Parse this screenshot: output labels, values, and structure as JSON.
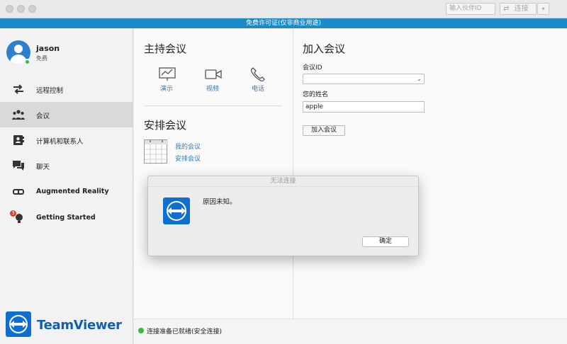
{
  "titlebar": {
    "partner_id_placeholder": "输入伙伴ID",
    "connect_label": "连接",
    "connect_dropdown": "▾"
  },
  "license_banner": "免费许可证(仅非商业用途)",
  "user": {
    "name": "jason",
    "plan": "免费"
  },
  "sidebar": {
    "items": [
      {
        "label": "远程控制",
        "icon": "arrows-icon",
        "active": false
      },
      {
        "label": "会议",
        "icon": "meeting-people-icon",
        "active": true
      },
      {
        "label": "计算机和联系人",
        "icon": "contacts-icon",
        "active": false
      },
      {
        "label": "聊天",
        "icon": "chat-icon",
        "active": false
      },
      {
        "label": "Augmented Reality",
        "icon": "ar-goggles-icon",
        "active": false
      },
      {
        "label": "Getting Started",
        "icon": "lightbulb-icon",
        "badge": "3",
        "active": false
      }
    ],
    "logo_text": "TeamViewer"
  },
  "host_meeting": {
    "title": "主持会议",
    "options": [
      {
        "label": "演示",
        "icon": "presentation-icon"
      },
      {
        "label": "视频",
        "icon": "video-camera-icon"
      },
      {
        "label": "电话",
        "icon": "phone-icon"
      }
    ]
  },
  "schedule_meeting": {
    "title": "安排会议",
    "links": [
      "我的会议",
      "安排会议"
    ]
  },
  "join_meeting": {
    "title": "加入会议",
    "meeting_id_label": "会议ID",
    "meeting_id_value": "",
    "name_label": "您的姓名",
    "name_value": "apple",
    "join_button": "加入会议"
  },
  "status": {
    "text": "连接准备已就绪(安全连接)",
    "color": "#3db547"
  },
  "dialog": {
    "title": "无法连接",
    "message": "原因未知。",
    "ok_button": "确定"
  },
  "colors": {
    "accent": "#1a8ac9",
    "link": "#2b7bc4",
    "brand": "#0e6fd1"
  }
}
